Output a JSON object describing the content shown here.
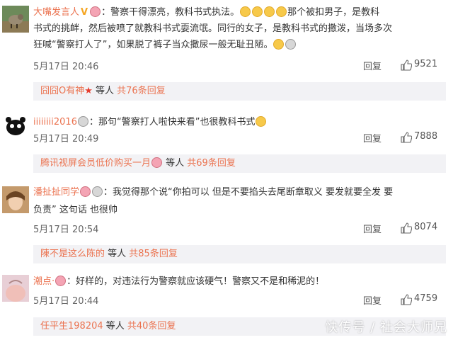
{
  "comments": [
    {
      "username": "大嘴发言人",
      "lines": [
        {
          "text_a": "：警察干得漂亮，教科书式执法。",
          "text_b": "那个被扣男子，是教科"
        },
        {
          "text_a": "书式的挑衅，然后被喷了就教科书式耍流氓。同行的女子，是教科书式的撒泼，当场多次"
        },
        {
          "text_a": "狂喊“警察打人了”，如果脱了裤子当众撒尿一般无耻丑陋。"
        }
      ],
      "date": "5月17日 20:46",
      "reply_label": "回复",
      "likes": "9521",
      "sub_user": "囧囧O有神",
      "sub_middle": " 等人 ",
      "sub_count": "共76条回复"
    },
    {
      "username": "iiiiiiii2016",
      "lines": [
        {
          "text_a": "：那句“警察打人啦快来看”也很教科书式"
        }
      ],
      "date": "5月17日 20:49",
      "reply_label": "回复",
      "likes": "7888",
      "sub_user": "腾讯视屏会员低价购买一月",
      "sub_middle": " 等人 ",
      "sub_count": "共69条回复"
    },
    {
      "username": "潘扯扯同学",
      "lines": [
        {
          "text_a": "：我觉得那个说“你拍可以 但是不要掐头去尾断章取义 要发就要全发 要"
        },
        {
          "text_a": "负责” 这句话 也很帅"
        }
      ],
      "date": "5月17日 20:54",
      "reply_label": "回复",
      "likes": "8074",
      "sub_user": "陳不是这么陈的",
      "sub_middle": " 等人 ",
      "sub_count": "共85条回复"
    },
    {
      "username": "潮点·",
      "lines": [
        {
          "text_a": "：好样的，对违法行为警察就应该硬气！警察又不是和稀泥的！"
        }
      ],
      "date": "5月17日 20:44",
      "reply_label": "回复",
      "likes": "4759",
      "sub_user": "任平生198204",
      "sub_middle": " 等人 ",
      "sub_count": "共40条回复"
    }
  ],
  "watermark": "快传号 / 社会大师兄",
  "colors": {
    "username": "#eb7350",
    "reply_box_bg": "#f2f2f5",
    "text": "#333333"
  }
}
